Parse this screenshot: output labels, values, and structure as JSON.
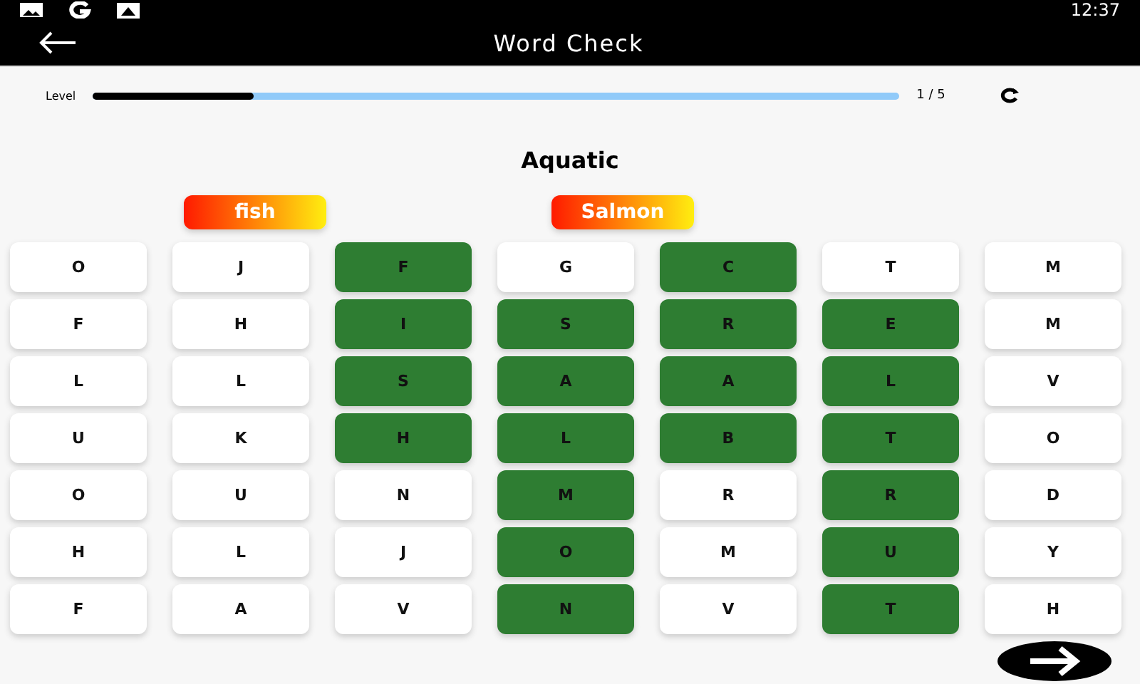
{
  "status_bar": {
    "time": "12:37"
  },
  "app_bar": {
    "title": "Word Check"
  },
  "progress": {
    "label": "Level",
    "level": 0.2,
    "reading": "1 / 5"
  },
  "category": "Aquatic",
  "found_words": [
    {
      "text": "fish"
    },
    {
      "text": "Salmon"
    }
  ],
  "grid": [
    [
      {
        "letter": "O",
        "selected": false
      },
      {
        "letter": "J",
        "selected": false
      },
      {
        "letter": "F",
        "selected": true
      },
      {
        "letter": "G",
        "selected": false
      },
      {
        "letter": "C",
        "selected": true
      },
      {
        "letter": "T",
        "selected": false
      },
      {
        "letter": "M",
        "selected": false
      }
    ],
    [
      {
        "letter": "F",
        "selected": false
      },
      {
        "letter": "H",
        "selected": false
      },
      {
        "letter": "I",
        "selected": true
      },
      {
        "letter": "S",
        "selected": true
      },
      {
        "letter": "R",
        "selected": true
      },
      {
        "letter": "E",
        "selected": true
      },
      {
        "letter": "M",
        "selected": false
      }
    ],
    [
      {
        "letter": "L",
        "selected": false
      },
      {
        "letter": "L",
        "selected": false
      },
      {
        "letter": "S",
        "selected": true
      },
      {
        "letter": "A",
        "selected": true
      },
      {
        "letter": "A",
        "selected": true
      },
      {
        "letter": "L",
        "selected": true
      },
      {
        "letter": "V",
        "selected": false
      }
    ],
    [
      {
        "letter": "U",
        "selected": false
      },
      {
        "letter": "K",
        "selected": false
      },
      {
        "letter": "H",
        "selected": true
      },
      {
        "letter": "L",
        "selected": true
      },
      {
        "letter": "B",
        "selected": true
      },
      {
        "letter": "T",
        "selected": true
      },
      {
        "letter": "O",
        "selected": false
      }
    ],
    [
      {
        "letter": "O",
        "selected": false
      },
      {
        "letter": "U",
        "selected": false
      },
      {
        "letter": "N",
        "selected": false
      },
      {
        "letter": "M",
        "selected": true
      },
      {
        "letter": "R",
        "selected": false
      },
      {
        "letter": "R",
        "selected": true
      },
      {
        "letter": "D",
        "selected": false
      }
    ],
    [
      {
        "letter": "H",
        "selected": false
      },
      {
        "letter": "L",
        "selected": false
      },
      {
        "letter": "J",
        "selected": false
      },
      {
        "letter": "O",
        "selected": true
      },
      {
        "letter": "M",
        "selected": false
      },
      {
        "letter": "U",
        "selected": true
      },
      {
        "letter": "Y",
        "selected": false
      }
    ],
    [
      {
        "letter": "F",
        "selected": false
      },
      {
        "letter": "A",
        "selected": false
      },
      {
        "letter": "V",
        "selected": false
      },
      {
        "letter": "N",
        "selected": true
      },
      {
        "letter": "V",
        "selected": false
      },
      {
        "letter": "T",
        "selected": true
      },
      {
        "letter": "H",
        "selected": false
      }
    ]
  ]
}
